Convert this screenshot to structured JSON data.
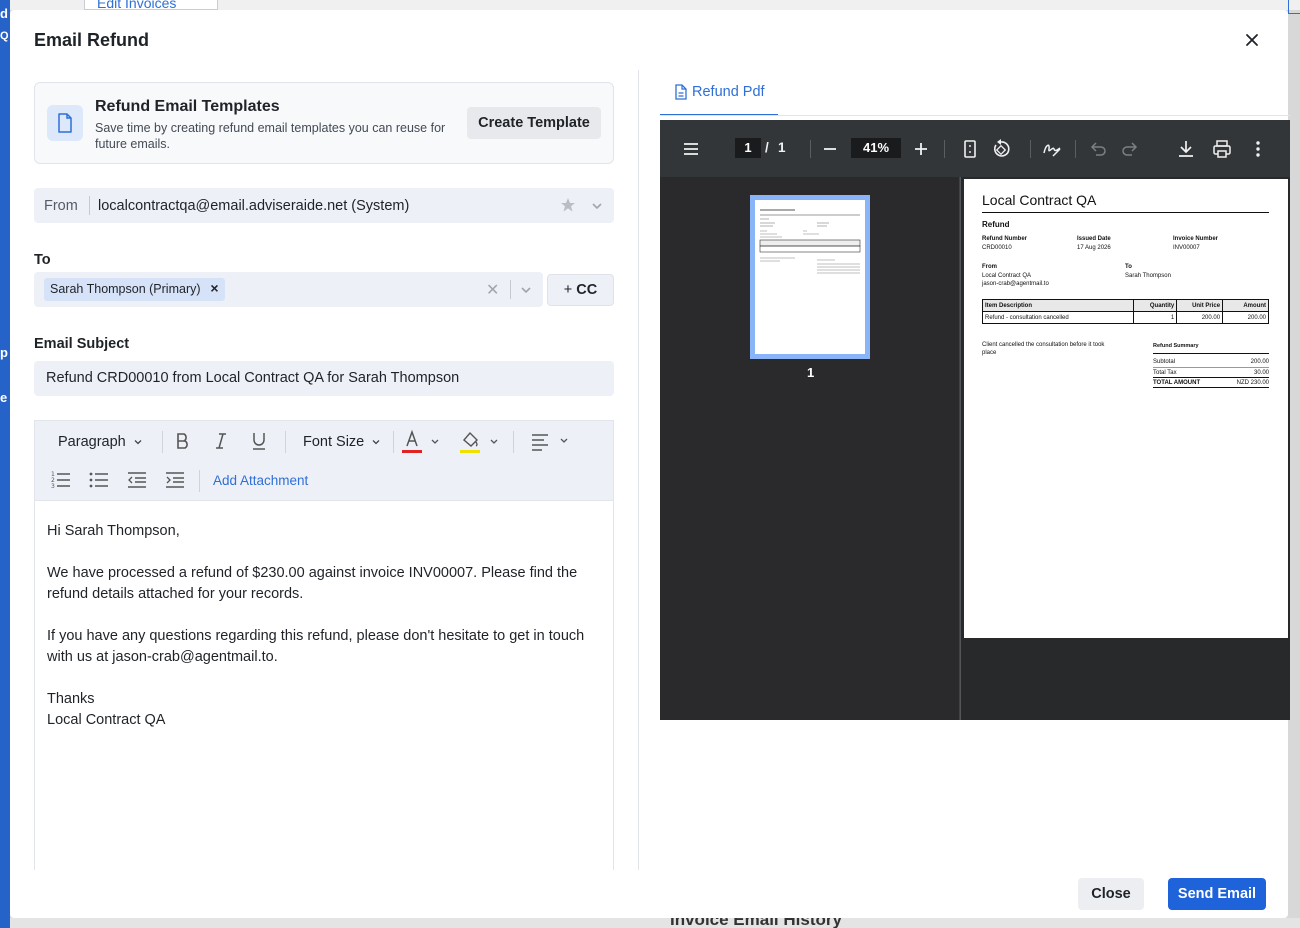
{
  "background": {
    "tab_label": "Edit Invoices",
    "bottom_heading": "Invoice Email History"
  },
  "modal": {
    "title": "Email Refund",
    "close_icon": "close-icon"
  },
  "templates": {
    "title": "Refund Email Templates",
    "description": "Save time by creating refund email templates you can reuse for future emails.",
    "create_button": "Create Template"
  },
  "from": {
    "label": "From",
    "value": "localcontractqa@email.adviseraide.net (System)"
  },
  "to": {
    "label": "To",
    "chips": [
      "Sarah Thompson (Primary)"
    ],
    "cc_button": "CC"
  },
  "subject": {
    "label": "Email Subject",
    "value": "Refund CRD00010 from Local Contract QA for Sarah Thompson"
  },
  "toolbar": {
    "paragraph": "Paragraph",
    "font_size": "Font Size",
    "add_attachment": "Add Attachment",
    "text_color": "#e02424",
    "highlight_color": "#f0e000"
  },
  "body": {
    "lines": [
      "Hi Sarah Thompson,",
      "We have processed a refund of $230.00 against invoice INV00007. Please find the refund details attached for your records.",
      "If you have any questions regarding this refund, please don't hesitate to get in touch with us at jason-crab@agentmail.to.",
      "Thanks\nLocal Contract QA"
    ]
  },
  "pdf_tab": {
    "label": "Refund Pdf"
  },
  "viewer": {
    "page_current": "1",
    "page_separator": "/",
    "page_total": "1",
    "zoom": "41%",
    "thumb_number": "1"
  },
  "pdf": {
    "company": "Local Contract QA",
    "doc_title": "Refund",
    "refund_number_label": "Refund Number",
    "refund_number": "CRD00010",
    "issued_date_label": "Issued Date",
    "issued_date": "17 Aug 2026",
    "invoice_number_label": "Invoice Number",
    "invoice_number": "INV00007",
    "from_label": "From",
    "from_name": "Local Contract QA",
    "from_email": "jason-crab@agentmail.to",
    "to_label": "To",
    "to_name": "Sarah Thompson",
    "table_headers": [
      "Item Description",
      "Quantity",
      "Unit Price",
      "Amount"
    ],
    "table_rows": [
      [
        "Refund - consultation cancelled",
        "1",
        "200.00",
        "200.00"
      ]
    ],
    "note": "Client cancelled the consultation before it took place",
    "summary_title": "Refund Summary",
    "subtotal_label": "Subtotal",
    "subtotal": "200.00",
    "tax_label": "Total Tax",
    "tax": "30.00",
    "total_label": "TOTAL AMOUNT",
    "total": "NZD 230.00"
  },
  "footer": {
    "close_button": "Close",
    "send_button": "Send Email"
  }
}
